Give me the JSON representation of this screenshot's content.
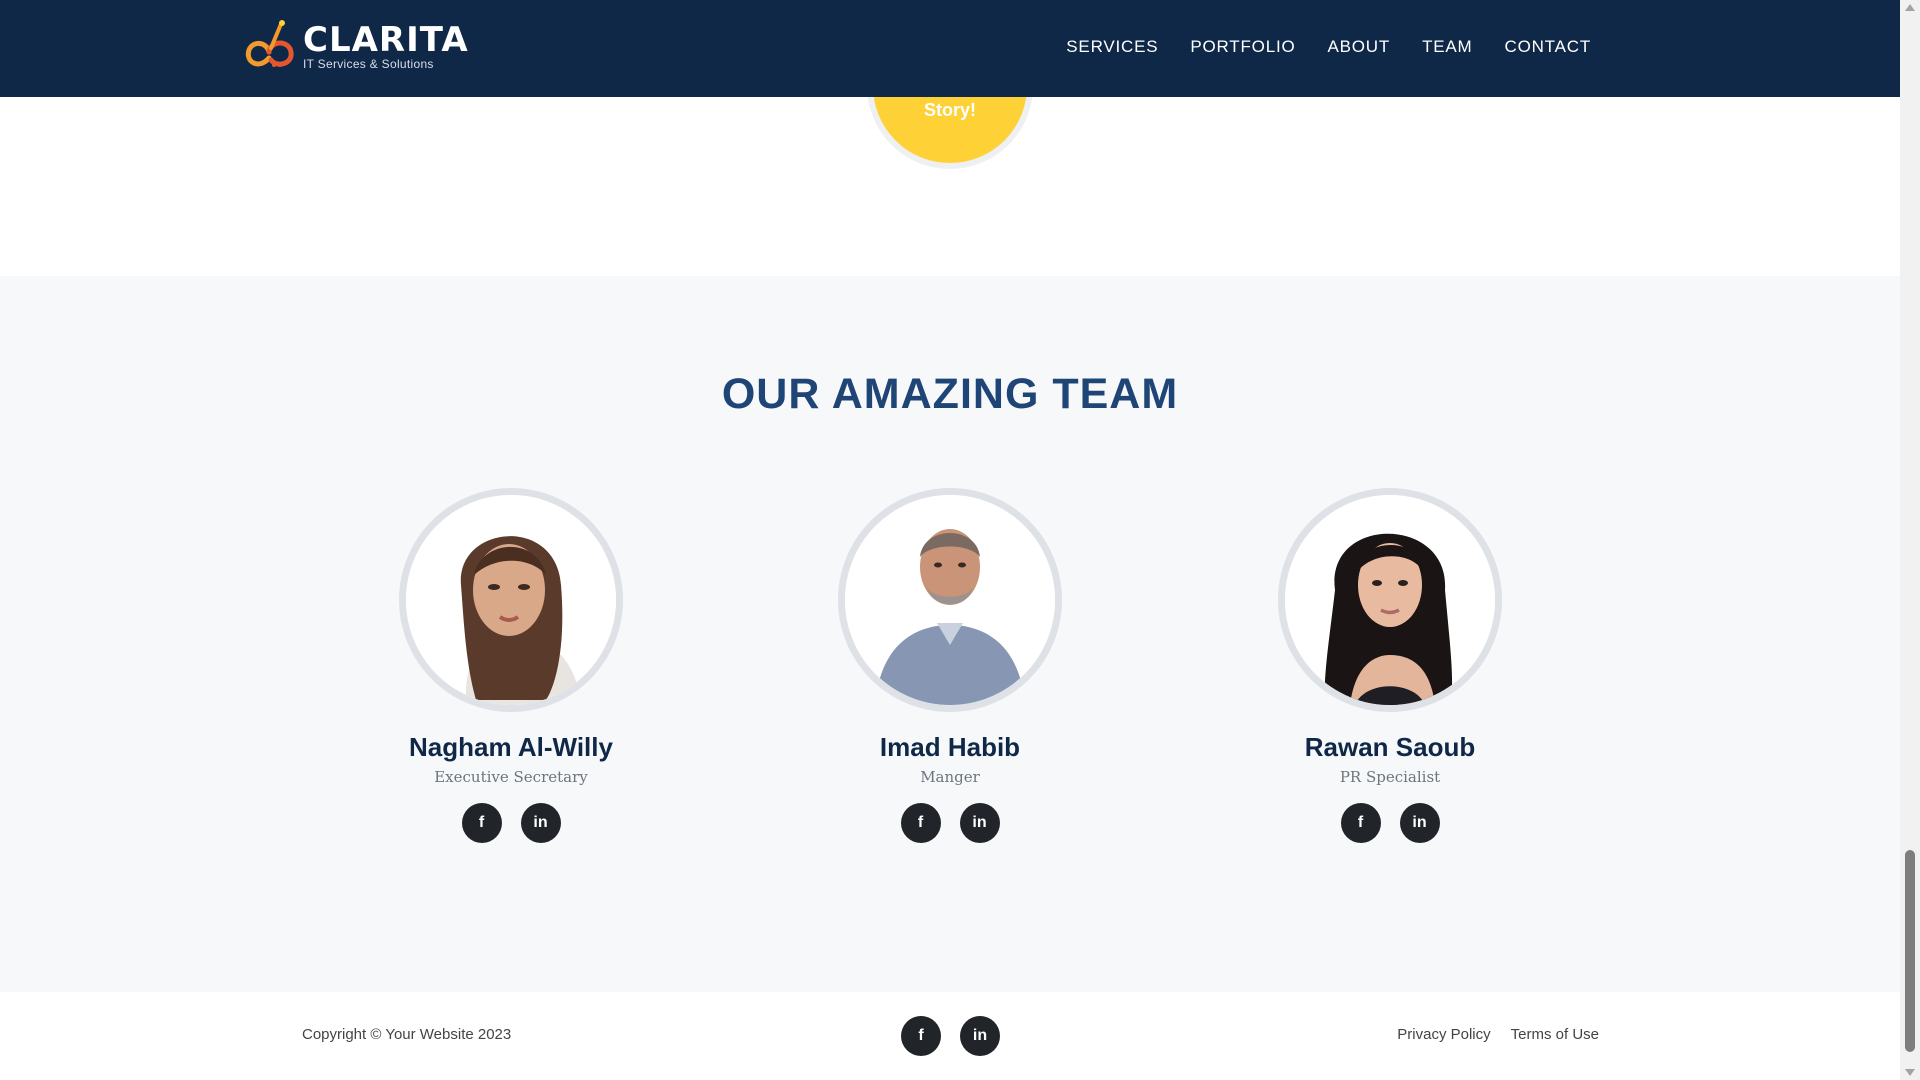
{
  "brand": {
    "name": "CLARITA",
    "tagline": "IT Services & Solutions",
    "colors": {
      "orange": "#f29a2e",
      "red": "#e4572e",
      "yellow": "#fed136"
    }
  },
  "nav": {
    "items": [
      {
        "label": "SERVICES"
      },
      {
        "label": "PORTFOLIO"
      },
      {
        "label": "ABOUT"
      },
      {
        "label": "TEAM"
      },
      {
        "label": "CONTACT"
      }
    ]
  },
  "story": {
    "label": "Story!"
  },
  "team": {
    "title": "OUR AMAZING TEAM",
    "members": [
      {
        "name": "Nagham Al-Willy",
        "role": "Executive Secretary",
        "facebook_icon": "f",
        "linkedin_icon": "in"
      },
      {
        "name": "Imad Habib",
        "role": "Manger",
        "facebook_icon": "f",
        "linkedin_icon": "in"
      },
      {
        "name": "Rawan Saoub",
        "role": "PR Specialist",
        "facebook_icon": "f",
        "linkedin_icon": "in"
      }
    ]
  },
  "footer": {
    "copyright": "Copyright © Your Website 2023",
    "facebook_icon": "f",
    "linkedin_icon": "in",
    "privacy": "Privacy Policy",
    "terms": "Terms of Use"
  },
  "theme": {
    "navbar_bg": "#0f2848",
    "title_color": "#1f4576",
    "section_bg": "#f7f8fa",
    "social_bg": "#212529"
  }
}
